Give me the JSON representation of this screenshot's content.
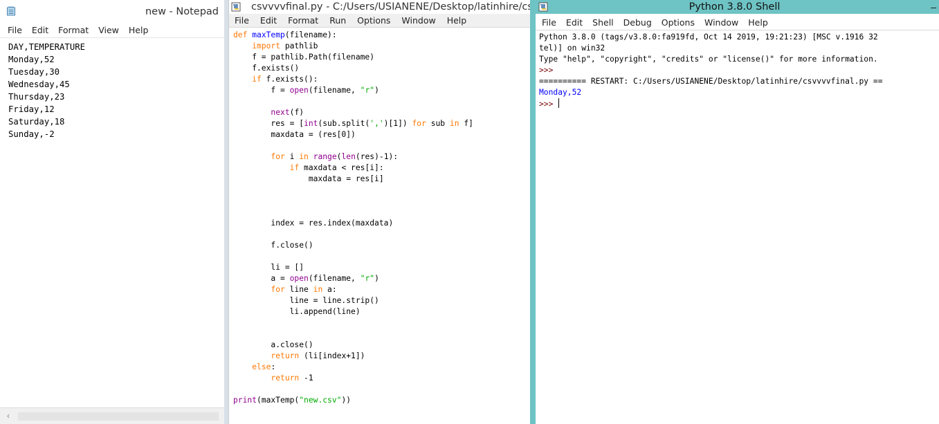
{
  "notepad": {
    "title": "new - Notepad",
    "menu": [
      "File",
      "Edit",
      "Format",
      "View",
      "Help"
    ],
    "lines": [
      "DAY,TEMPERATURE",
      "Monday,52",
      "Tuesday,30",
      "Wednesday,45",
      "Thursday,23",
      "Friday,12",
      "Saturday,18",
      "Sunday,-2"
    ]
  },
  "editor": {
    "title": "csvvvvfinal.py - C:/Users/USIANENE/Desktop/latinhire/csvv",
    "menu": [
      "File",
      "Edit",
      "Format",
      "Run",
      "Options",
      "Window",
      "Help"
    ],
    "code": "def maxTemp(filename):\n    import pathlib\n    f = pathlib.Path(filename)\n    f.exists()\n    if f.exists():\n        f = open(filename, \"r\")\n\n        next(f)\n        res = [int(sub.split(',')[1]) for sub in f]\n        maxdata = (res[0])\n\n        for i in range(len(res)-1):\n            if maxdata < res[i]:\n                maxdata = res[i]\n\n\n\n        index = res.index(maxdata)\n\n        f.close()\n\n        li = []\n        a = open(filename, \"r\")\n        for line in a:\n            line = line.strip()\n            li.append(line)\n\n\n        a.close()\n        return (li[index+1])\n    else:\n        return -1\n\nprint(maxTemp(\"new.csv\"))"
  },
  "shell": {
    "title": "Python 3.8.0 Shell",
    "menu": [
      "File",
      "Edit",
      "Shell",
      "Debug",
      "Options",
      "Window",
      "Help"
    ],
    "banner_1": "Python 3.8.0 (tags/v3.8.0:fa919fd, Oct 14 2019, 19:21:23) [MSC v.1916 32",
    "banner_2": "tel)] on win32",
    "banner_3": "Type \"help\", \"copyright\", \"credits\" or \"license()\" for more information.",
    "prompt_1": ">>>",
    "restart": "========== RESTART: C:/Users/USIANENE/Desktop/latinhire/csvvvvfinal.py ==",
    "output": "Monday,52",
    "prompt_2": ">>> "
  }
}
